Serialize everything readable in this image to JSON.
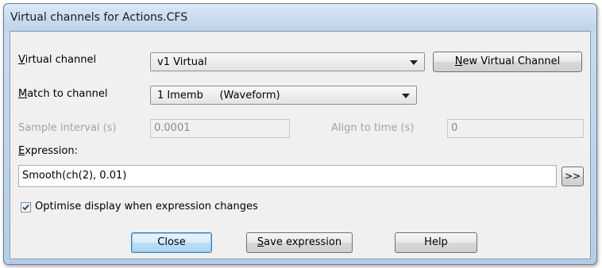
{
  "window": {
    "title": "Virtual channels for Actions.CFS"
  },
  "form": {
    "virtual_channel": {
      "label_u": "V",
      "label_rest": "irtual channel",
      "value": "v1 Virtual"
    },
    "new_channel_button": {
      "label_u": "N",
      "label_rest": "ew Virtual Channel"
    },
    "match_channel": {
      "label_u": "M",
      "label_rest": "atch to channel",
      "value": "1 Imemb     (Waveform)"
    },
    "sample_interval": {
      "label": "Sample interval (s)",
      "value": "0.0001"
    },
    "align_time": {
      "label": "Align to time (s)",
      "value": "0"
    },
    "expression": {
      "label_u": "E",
      "label_rest": "xpression:",
      "value": "Smooth(ch(2), 0.01)"
    },
    "expand_button": {
      "label": ">>"
    },
    "optimise": {
      "label": "Optimise display when expression changes",
      "checked": true
    }
  },
  "buttons": {
    "close": "Close",
    "save_u": "S",
    "save_rest": "ave expression",
    "help": "Help"
  }
}
